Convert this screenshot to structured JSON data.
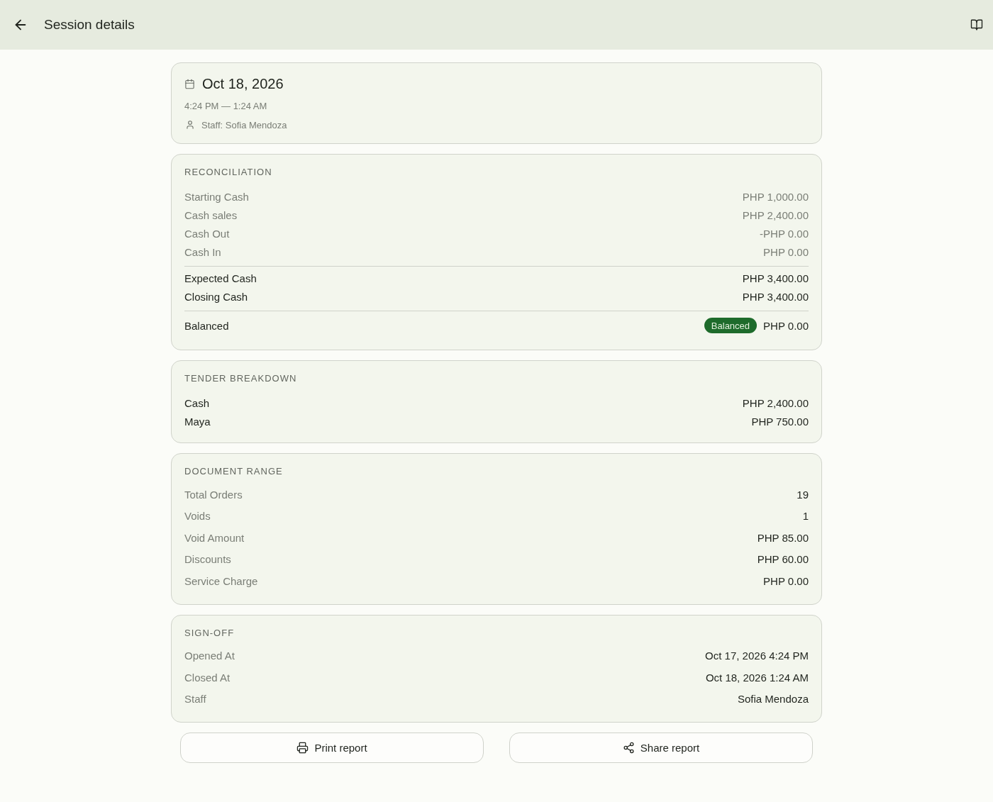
{
  "header": {
    "title": "Session details"
  },
  "summary": {
    "date": "Oct 18, 2026",
    "time_range": "4:24 PM — 1:24 AM",
    "staff": "Staff: Sofia Mendoza"
  },
  "cards": [
    {
      "title": "RECONCILIATION",
      "sections": [
        {
          "rows": [
            {
              "kind": "detail",
              "label": "Starting Cash",
              "value": "PHP 1,000.00"
            },
            {
              "kind": "detail",
              "label": "Cash sales",
              "value": "PHP 2,400.00"
            },
            {
              "kind": "detail",
              "label": "Cash Out",
              "value": "-PHP 0.00"
            },
            {
              "kind": "detail",
              "label": "Cash In",
              "value": "PHP 0.00"
            }
          ]
        },
        {
          "rows": [
            {
              "kind": "total",
              "label": "Expected Cash",
              "value": "PHP 3,400.00"
            },
            {
              "kind": "total",
              "label": "Closing Cash",
              "value": "PHP 3,400.00"
            }
          ]
        },
        {
          "rows": [
            {
              "kind": "total",
              "label": "Balanced",
              "value": "PHP 0.00",
              "badge": "Balanced"
            }
          ]
        }
      ]
    },
    {
      "title": "TENDER BREAKDOWN",
      "sections": [
        {
          "rows": [
            {
              "kind": "total",
              "label": "Cash",
              "value": "PHP 2,400.00"
            },
            {
              "kind": "total",
              "label": "Maya",
              "value": "PHP 750.00"
            }
          ]
        }
      ]
    },
    {
      "title": "DOCUMENT RANGE",
      "sections": [
        {
          "rows": [
            {
              "kind": "metric",
              "label": "Total Orders",
              "value": "19"
            },
            {
              "kind": "metric",
              "label": "Voids",
              "value": "1"
            },
            {
              "kind": "metric",
              "label": "Void Amount",
              "value": "PHP 85.00"
            },
            {
              "kind": "metric",
              "label": "Discounts",
              "value": "PHP 60.00"
            },
            {
              "kind": "metric",
              "label": "Service Charge",
              "value": "PHP 0.00"
            }
          ]
        }
      ]
    },
    {
      "title": "SIGN-OFF",
      "sections": [
        {
          "rows": [
            {
              "kind": "metric",
              "label": "Opened At",
              "value": "Oct 17, 2026 4:24 PM"
            },
            {
              "kind": "metric",
              "label": "Closed At",
              "value": "Oct 18, 2026 1:24 AM"
            },
            {
              "kind": "metric",
              "label": "Staff",
              "value": "Sofia Mendoza"
            }
          ]
        }
      ]
    }
  ],
  "actions": [
    {
      "label": "Print report"
    },
    {
      "label": "Share report"
    }
  ]
}
